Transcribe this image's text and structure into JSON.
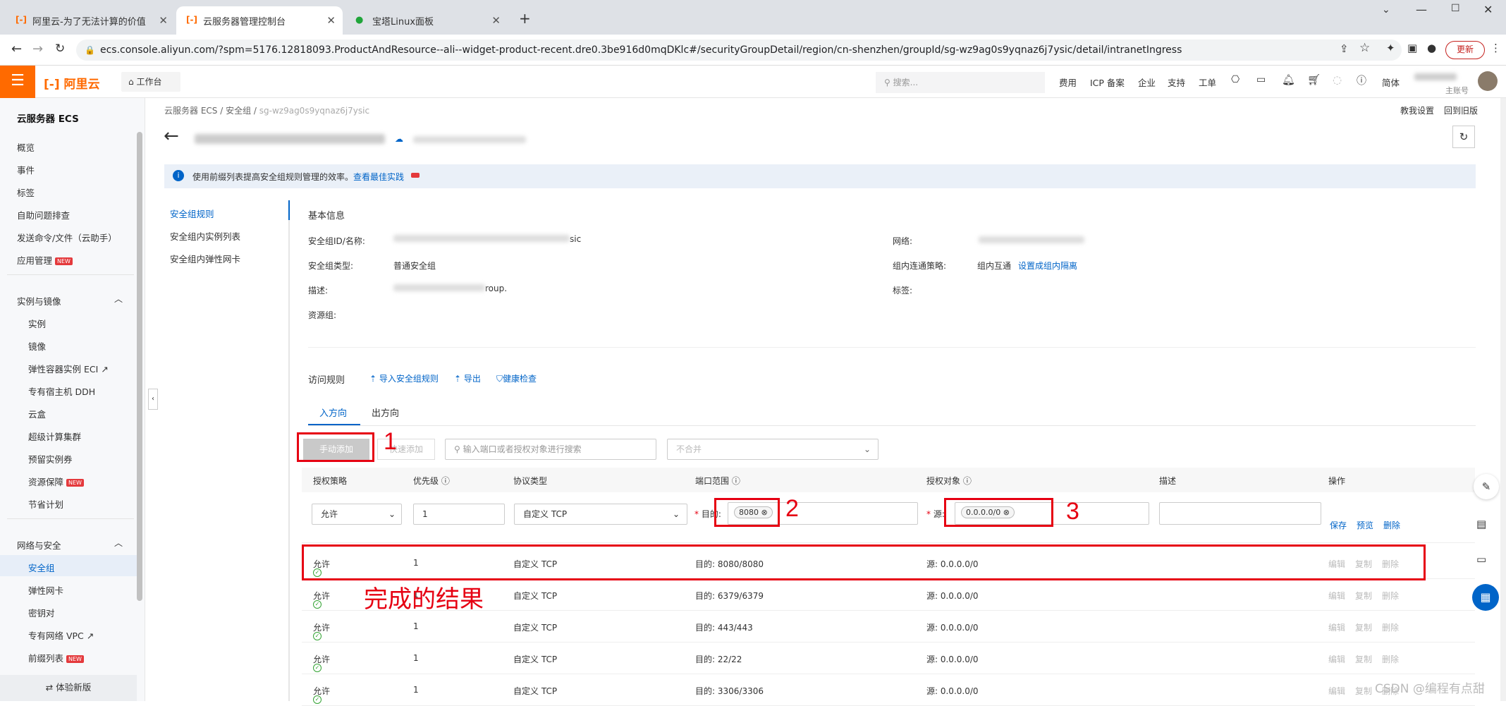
{
  "browser": {
    "tabs": [
      {
        "label": "阿里云-为了无法计算的价值",
        "active": false
      },
      {
        "label": "云服务器管理控制台",
        "active": true
      },
      {
        "label": "宝塔Linux面板",
        "active": false
      }
    ],
    "url": "ecs.console.aliyun.com/?spm=5176.12818093.ProductAndResource--ali--widget-product-recent.dre0.3be916d0mqDKlc#/securityGroupDetail/region/cn-shenzhen/groupId/sg-wz9ag0s9yqnaz6j7ysic/detail/intranetIngress",
    "update_label": "更新"
  },
  "topnav": {
    "logo": "阿里云",
    "workbench": "工作台",
    "search_placeholder": "搜索...",
    "links": [
      "费用",
      "ICP 备案",
      "企业",
      "支持",
      "工单"
    ],
    "lang": "简体",
    "account": "主账号"
  },
  "sidebar": {
    "title": "云服务器 ECS",
    "top_items": [
      "概览",
      "事件",
      "标签",
      "自助问题排查",
      "发送命令/文件（云助手）",
      "应用管理"
    ],
    "group1": "实例与镜像",
    "group1_items": [
      "实例",
      "镜像",
      "弹性容器实例 ECI",
      "专有宿主机 DDH",
      "云盒",
      "超级计算集群",
      "预留实例券",
      "资源保障",
      "节省计划"
    ],
    "group2": "网络与安全",
    "group2_items": [
      "安全组",
      "弹性网卡",
      "密钥对",
      "专有网络 VPC",
      "前缀列表"
    ],
    "footer": "体验新版",
    "new_badge": "NEW"
  },
  "breadcrumb": {
    "items": [
      "云服务器 ECS",
      "安全组",
      "sg-wz9ag0s9yqnaz6j7ysic"
    ]
  },
  "header_links": {
    "tutorial": "教我设置",
    "old_version": "回到旧版"
  },
  "notice": {
    "text": "使用前缀列表提高安全组规则管理的效率。",
    "link": "查看最佳实践"
  },
  "subnav": [
    "安全组规则",
    "安全组内实例列表",
    "安全组内弹性网卡"
  ],
  "basic_info": {
    "title": "基本信息",
    "id_label": "安全组ID/名称:",
    "id_suffix": "sic",
    "type_label": "安全组类型:",
    "type_value": "普通安全组",
    "desc_label": "描述:",
    "desc_suffix": "roup.",
    "rg_label": "资源组:",
    "network_label": "网络:",
    "policy_label": "组内连通策略:",
    "policy_value": "组内互通",
    "policy_link": "设置成组内隔离",
    "tag_label": "标签:"
  },
  "rules": {
    "title": "访问规则",
    "import": "导入安全组规则",
    "export": "导出",
    "health": "健康检查",
    "tabs": [
      "入方向",
      "出方向"
    ],
    "manual_add": "手动添加",
    "quick_add": "快速添加",
    "search_placeholder": "输入端口或者授权对象进行搜索",
    "merge_placeholder": "不合并",
    "columns": [
      "授权策略",
      "优先级",
      "协议类型",
      "端口范围",
      "授权对象",
      "描述",
      "操作"
    ],
    "edit_row": {
      "policy": "允许",
      "priority": "1",
      "protocol": "自定义 TCP",
      "dest_label": "目的:",
      "port_tag": "8080",
      "src_label": "源:",
      "src_tag": "0.0.0.0/0",
      "actions": [
        "保存",
        "预览",
        "删除"
      ]
    },
    "row_actions": [
      "编辑",
      "复制",
      "删除"
    ],
    "rows": [
      {
        "policy": "允许",
        "priority": "1",
        "protocol": "自定义 TCP",
        "port": "目的: 8080/8080",
        "source": "源: 0.0.0.0/0"
      },
      {
        "policy": "允许",
        "priority": "1",
        "protocol": "自定义 TCP",
        "port": "目的: 6379/6379",
        "source": "源: 0.0.0.0/0"
      },
      {
        "policy": "允许",
        "priority": "1",
        "protocol": "自定义 TCP",
        "port": "目的: 443/443",
        "source": "源: 0.0.0.0/0"
      },
      {
        "policy": "允许",
        "priority": "1",
        "protocol": "自定义 TCP",
        "port": "目的: 22/22",
        "source": "源: 0.0.0.0/0"
      },
      {
        "policy": "允许",
        "priority": "1",
        "protocol": "自定义 TCP",
        "port": "目的: 3306/3306",
        "source": "源: 0.0.0.0/0"
      }
    ]
  },
  "annotations": {
    "n1": "1",
    "n2": "2",
    "n3": "3",
    "result": "完成的结果"
  },
  "watermark": "CSDN @编程有点甜"
}
